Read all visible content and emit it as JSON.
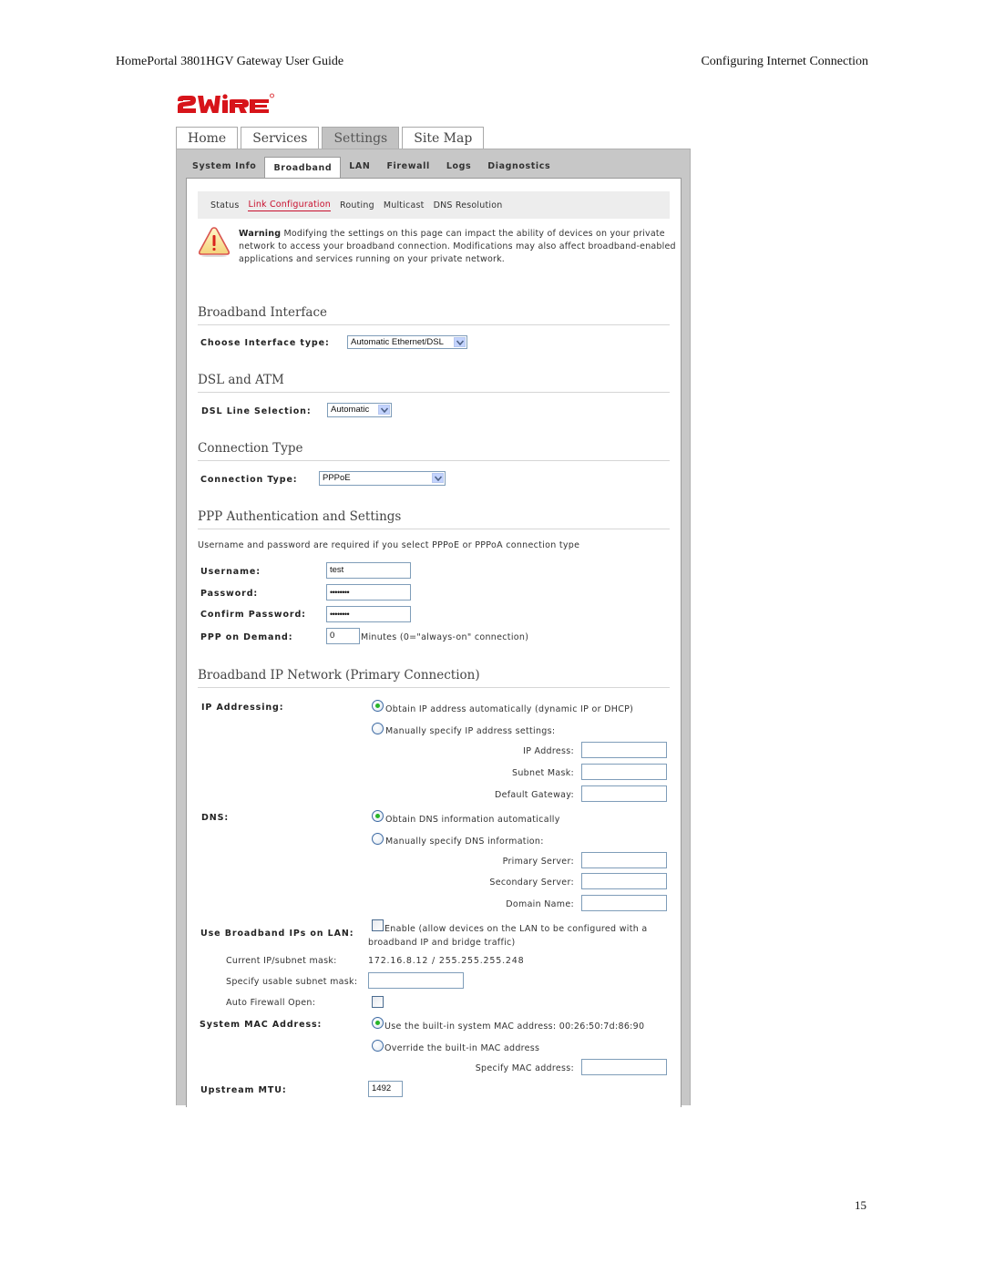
{
  "document": {
    "header_left": "HomePortal 3801HGV Gateway User Guide",
    "header_right": "Configuring Internet Connection",
    "page_number": "15"
  },
  "brand": {
    "logo_text": "2WIRE",
    "logo_color": "#d7141a"
  },
  "main_tabs": [
    {
      "label": "Home",
      "active": false
    },
    {
      "label": "Services",
      "active": false
    },
    {
      "label": "Settings",
      "active": true
    },
    {
      "label": "Site Map",
      "active": false
    }
  ],
  "sub_tabs": [
    {
      "label": "System Info",
      "active": false
    },
    {
      "label": "Broadband",
      "active": true
    },
    {
      "label": "LAN",
      "active": false
    },
    {
      "label": "Firewall",
      "active": false
    },
    {
      "label": "Logs",
      "active": false
    },
    {
      "label": "Diagnostics",
      "active": false
    }
  ],
  "link_bar": [
    {
      "label": "Status",
      "active": false
    },
    {
      "label": "Link Configuration",
      "active": true
    },
    {
      "label": "Routing",
      "active": false
    },
    {
      "label": "Multicast",
      "active": false
    },
    {
      "label": "DNS Resolution",
      "active": false
    }
  ],
  "warning": {
    "title": "Warning",
    "text": "Modifying the settings on this page can impact the ability of devices on your private network to access your broadband connection. Modifications may also affect broadband-enabled applications and services running on your private network."
  },
  "broadband_interface": {
    "title": "Broadband Interface",
    "label": "Choose Interface type:",
    "value": "Automatic Ethernet/DSL"
  },
  "dsl_atm": {
    "title": "DSL and ATM",
    "label": "DSL Line Selection:",
    "value": "Automatic"
  },
  "connection_type": {
    "title": "Connection Type",
    "label": "Connection Type:",
    "value": "PPPoE"
  },
  "ppp": {
    "title": "PPP Authentication and Settings",
    "note": "Username and password are required if you select PPPoE or PPPoA connection type",
    "username_label": "Username:",
    "username_value": "test",
    "password_label": "Password:",
    "password_value": "••••••••",
    "confirm_label": "Confirm Password:",
    "confirm_value": "••••••••",
    "demand_label": "PPP on Demand:",
    "demand_value": "0",
    "demand_suffix": "Minutes (0=\"always-on\" connection)"
  },
  "ip_network": {
    "title": "Broadband IP Network (Primary Connection)",
    "ip_addressing_label": "IP Addressing:",
    "ip_auto": "Obtain IP address automatically (dynamic IP or DHCP)",
    "ip_auto_checked": true,
    "ip_manual": "Manually specify IP address settings:",
    "ip_address_label": "IP Address:",
    "ip_address_value": "",
    "subnet_mask_label": "Subnet Mask:",
    "subnet_mask_value": "",
    "gateway_label": "Default Gateway:",
    "gateway_value": "",
    "dns_label": "DNS:",
    "dns_auto": "Obtain DNS information automatically",
    "dns_auto_checked": true,
    "dns_manual": "Manually specify DNS information:",
    "primary_label": "Primary Server:",
    "primary_value": "",
    "secondary_label": "Secondary Server:",
    "secondary_value": "",
    "domain_label": "Domain Name:",
    "domain_value": "",
    "bip_label": "Use Broadband IPs on LAN:",
    "bip_enable_line1": "Enable (allow devices on the LAN to be configured with a",
    "bip_enable_line2": "broadband IP and bridge traffic)",
    "bip_enabled": false,
    "current_ip_label": "Current IP/subnet mask:",
    "current_ip_value": "172.16.8.12 / 255.255.255.248",
    "usable_mask_label": "Specify usable subnet mask:",
    "usable_mask_value": "",
    "auto_fw_label": "Auto Firewall Open:",
    "auto_fw_checked": false,
    "mac_label": "System MAC Address:",
    "mac_builtin": "Use the built-in system MAC address: 00:26:50:7d:86:90",
    "mac_builtin_checked": true,
    "mac_override": "Override the built-in MAC address",
    "mac_specify_label": "Specify MAC address:",
    "mac_specify_value": "",
    "mtu_label": "Upstream MTU:",
    "mtu_value": "1492"
  }
}
